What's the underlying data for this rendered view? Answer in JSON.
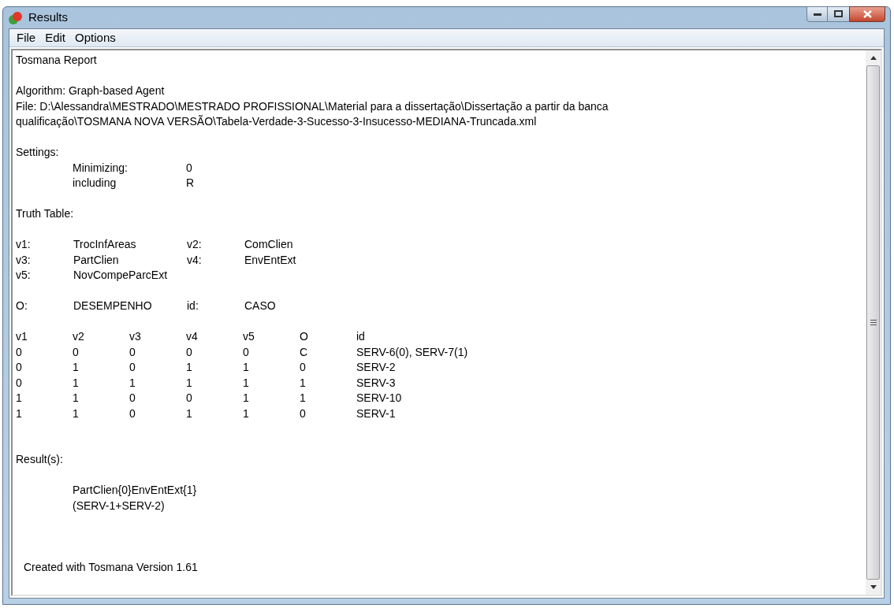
{
  "window": {
    "title": "Results"
  },
  "menu": [
    "File",
    "Edit",
    "Options"
  ],
  "report": {
    "title": "Tosmana Report",
    "algorithm": "Algorithm: Graph-based Agent",
    "file": "File: D:\\Alessandra\\MESTRADO\\MESTRADO PROFISSIONAL\\Material para a dissertação\\Dissertação a partir da banca qualificação\\TOSMANA NOVA VERSÃO\\Tabela-Verdade-3-Sucesso-3-Insucesso-MEDIANA-Truncada.xml",
    "settings_heading": "Settings:",
    "settings": [
      [
        "Minimizing:",
        "0"
      ],
      [
        "including",
        "R"
      ]
    ],
    "truth_table_heading": "Truth Table:",
    "variables": [
      [
        "v1:",
        "TrocInfAreas",
        "v2:",
        "ComClien"
      ],
      [
        "v3:",
        "PartClien",
        "v4:",
        "EnvEntExt"
      ],
      [
        "v5:",
        "NovCompeParcExt"
      ]
    ],
    "outcome": [
      "O:",
      "DESEMPENHO",
      "id:",
      "CASO"
    ],
    "table": {
      "columns": [
        "v1",
        "v2",
        "v3",
        "v4",
        "v5",
        "O",
        "id"
      ],
      "rows": [
        [
          "0",
          "0",
          "0",
          "0",
          "0",
          "C",
          "SERV-6(0), SERV-7(1)"
        ],
        [
          "0",
          "1",
          "0",
          "1",
          "1",
          "0",
          "SERV-2"
        ],
        [
          "0",
          "1",
          "1",
          "1",
          "1",
          "1",
          "SERV-3"
        ],
        [
          "1",
          "1",
          "0",
          "0",
          "1",
          "1",
          "SERV-10"
        ],
        [
          "1",
          "1",
          "0",
          "1",
          "1",
          "0",
          "SERV-1"
        ]
      ]
    },
    "results_heading": "Result(s):",
    "results": [
      "PartClien{0}EnvEntExt{1}",
      "(SERV-1+SERV-2)"
    ],
    "footer": "Created with Tosmana Version 1.61"
  }
}
